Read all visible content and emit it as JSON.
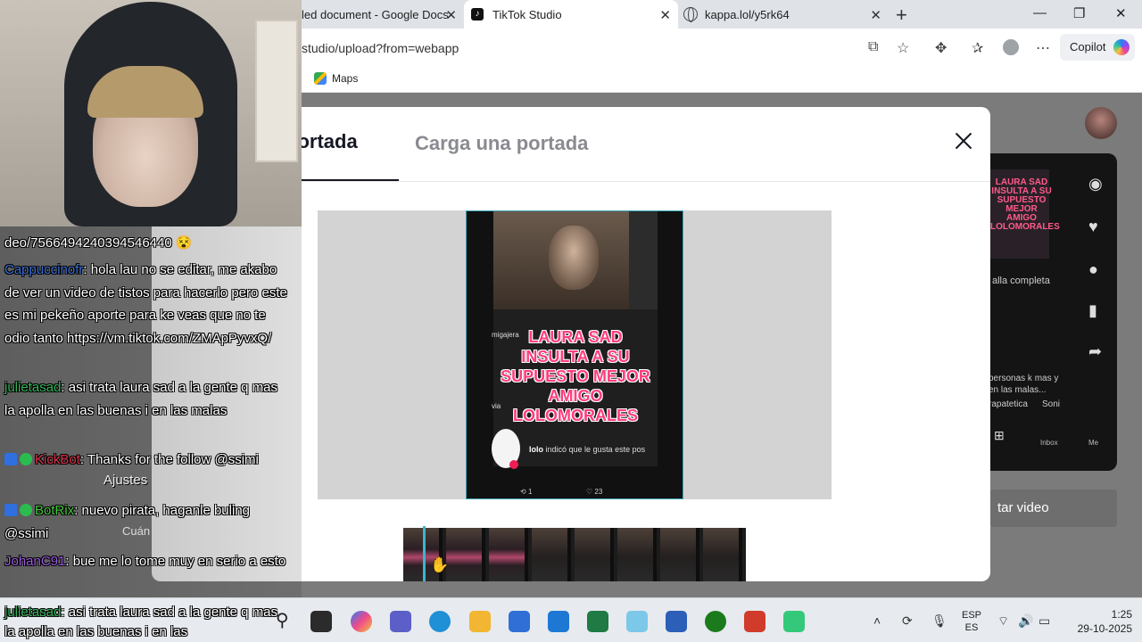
{
  "browser": {
    "tabs": [
      {
        "title": "led document - Google Docs"
      },
      {
        "title": "TikTok Studio"
      },
      {
        "title": "kappa.lol/y5rk64"
      }
    ],
    "url": "studio/upload?from=webapp",
    "copilot_label": "Copilot",
    "favorites": [
      {
        "label": "Maps"
      }
    ]
  },
  "modal": {
    "tabs": [
      {
        "label": "portada"
      },
      {
        "label": "Carga una portada"
      }
    ],
    "video_frame": {
      "overlay_title": "LAURA SAD INSULTA A SU SUPUESTO MEJOR AMIGO LOLOMORALES",
      "side_text_top": "migajera",
      "side_text_mid": "via",
      "comment_user": "lolo",
      "comment_text": "indicó que le gusta este pos",
      "reposts": "1",
      "likes": "23"
    }
  },
  "background_page": {
    "preview_more": "alla completa",
    "caption": "personas k mas y en las malas...",
    "music": "rapatetica",
    "music_2": "Soni",
    "nav_inbox": "Inbox",
    "nav_me": "Me",
    "post_button": "tar video"
  },
  "chat": {
    "lines": [
      {
        "user": "",
        "text": "deo/7566494240394546440"
      },
      {
        "user": "Cappuccinofr",
        "user_color": "#3b6fd6",
        "text": ": hola lau no se editar, me akabo de ver un video de tistos para hacerlo pero este es mi pekeño aporte para ke veas que no te odio tanto https://vm.tiktok.com/ZMApPyvxQ/"
      },
      {
        "user": "julietasad",
        "user_color": "#35b55a",
        "text": ": asi trata laura sad a la gente q mas la apolla en las buenas i en las malas"
      },
      {
        "user": "KickBot",
        "user_color": "#e0344a",
        "text": ": Thanks for the follow @ssimi"
      },
      {
        "user": "BotRix",
        "user_color": "#45c93e",
        "text": ": nuevo pirata, haganle buling @ssimi"
      },
      {
        "user": "JohanC91",
        "user_color": "#9b5ae0",
        "text": ": bue me lo tome muy en serio a esto"
      },
      {
        "user": "julietasad",
        "user_color": "#35b55a",
        "text": ": asi trata laura sad a la gente q mas la apolla en las buenas i en las"
      }
    ],
    "ghost_label_1": "Ajustes",
    "ghost_label_2": "Cuán"
  },
  "taskbar": {
    "lang_line1": "ESP",
    "lang_line2": "ES",
    "time": "1:25",
    "date": "29-10-2025"
  },
  "colors": {
    "accent": "#3ab6cf",
    "tiktok_pink": "#ff3d7f"
  }
}
